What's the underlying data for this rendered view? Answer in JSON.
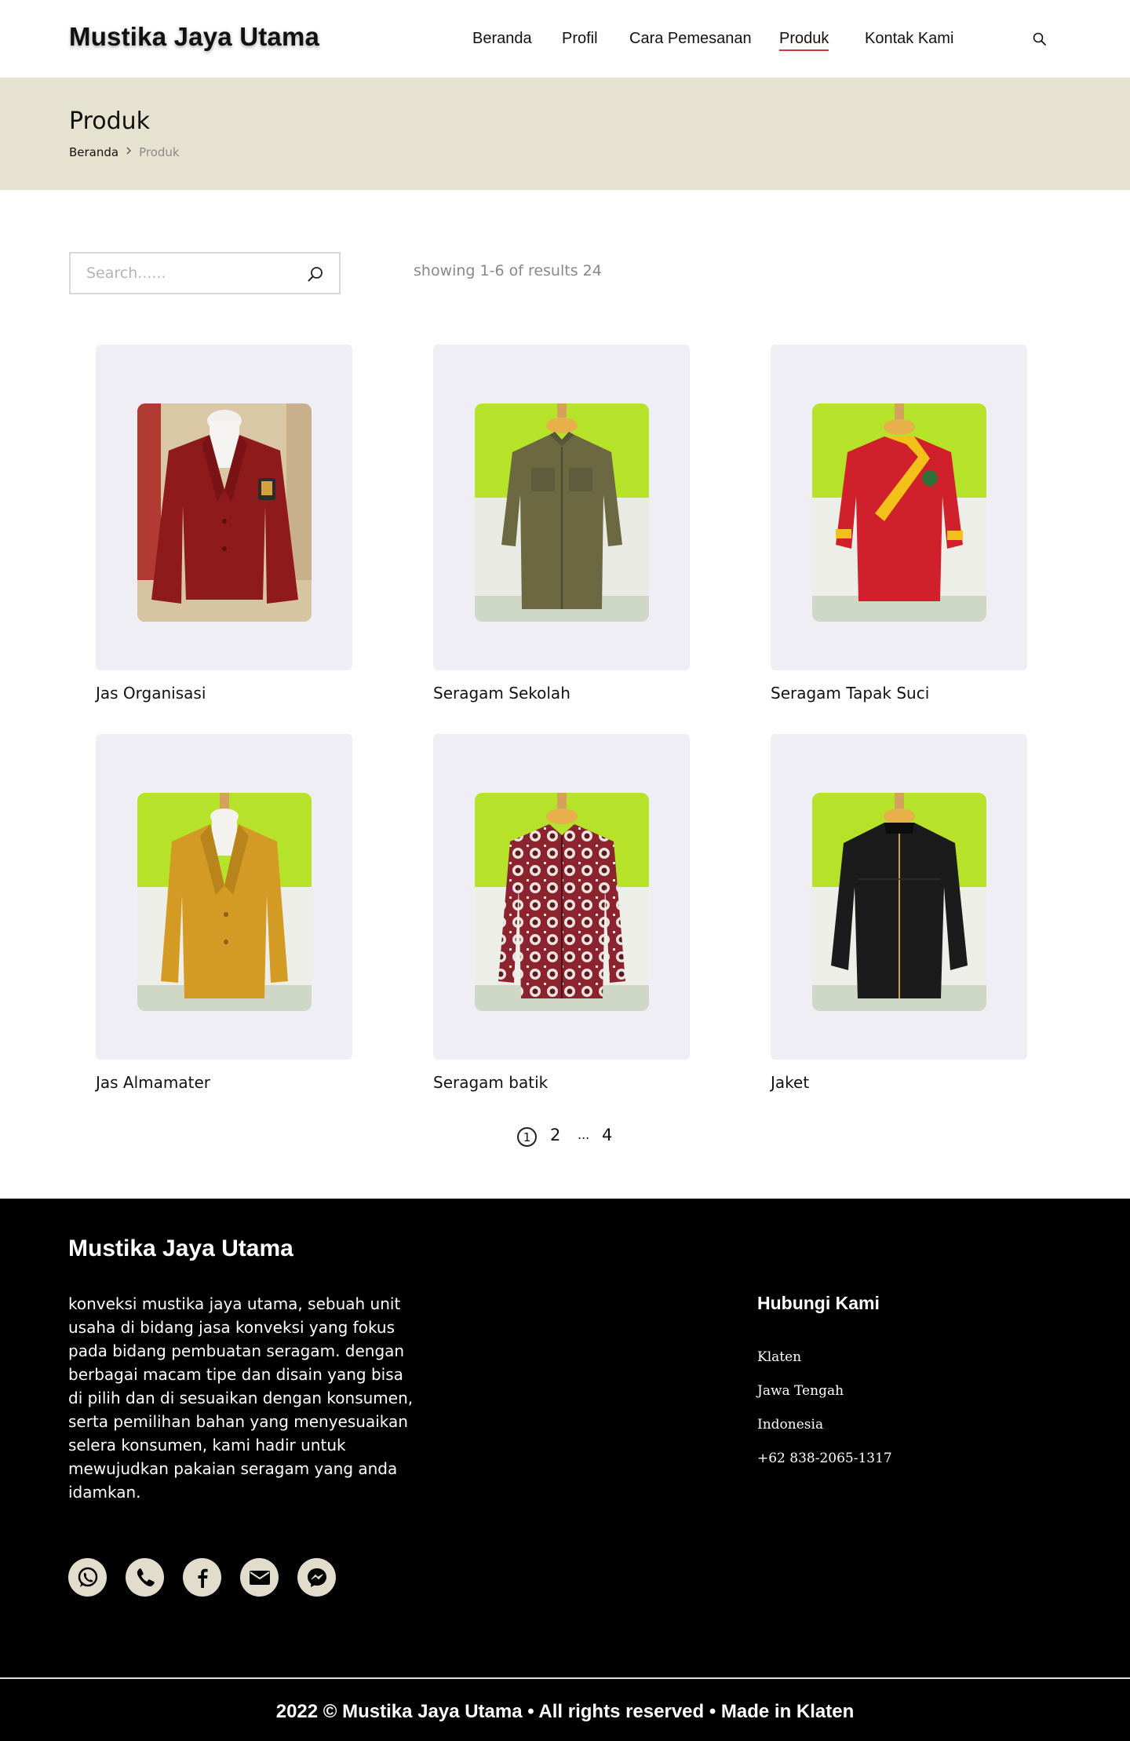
{
  "brand": {
    "name": "Mustika Jaya Utama",
    "accent_color": "#d6343c"
  },
  "nav": {
    "items": [
      {
        "label": "Beranda"
      },
      {
        "label": "Profil"
      },
      {
        "label": "Cara Pemesanan"
      },
      {
        "label": "Produk",
        "active": true
      },
      {
        "label": "Kontak Kami"
      }
    ],
    "search_icon": "search-icon"
  },
  "title_band": {
    "title": "Produk",
    "breadcrumb": {
      "home": "Beranda",
      "separator_icon": "chevron-right-icon",
      "current": "Produk"
    },
    "background": "#e6e2d0"
  },
  "search": {
    "placeholder": "Search......",
    "value": "",
    "icon": "search-icon"
  },
  "results": {
    "text": "showing 1-6 of results",
    "count": "24"
  },
  "products": [
    {
      "name": "Jas Organisasi",
      "image": "maroon-blazer-photo"
    },
    {
      "name": "Seragam Sekolah",
      "image": "olive-shirt-photo"
    },
    {
      "name": "Seragam Tapak Suci",
      "image": "red-martial-uniform-photo"
    },
    {
      "name": "Jas Almamater",
      "image": "mustard-blazer-photo"
    },
    {
      "name": "Seragam batik",
      "image": "batik-shirt-photo"
    },
    {
      "name": "Jaket",
      "image": "black-jacket-photo"
    }
  ],
  "pagination": {
    "current": "1",
    "pages": [
      "2",
      "...",
      "4"
    ]
  },
  "footer": {
    "brand": "Mustika Jaya Utama",
    "about": "konveksi mustika jaya utama, sebuah unit usaha di bidang jasa konveksi yang fokus pada bidang pembuatan seragam. dengan berbagai macam tipe dan disain yang bisa di pilih dan di sesuaikan dengan konsumen, serta pemilihan bahan yang menyesuaikan selera konsumen, kami hadir untuk mewujudkan pakaian seragam yang anda idamkan.",
    "contact_title": "Hubungi Kami",
    "contact": [
      "Klaten",
      "Jawa Tengah",
      "Indonesia",
      "+62 838-2065-1317"
    ],
    "socials": [
      "whatsapp-icon",
      "phone-icon",
      "facebook-icon",
      "email-icon",
      "messenger-icon"
    ],
    "copyright": "2022  ©  Mustika Jaya Utama • All rights reserved • Made in Klaten"
  }
}
